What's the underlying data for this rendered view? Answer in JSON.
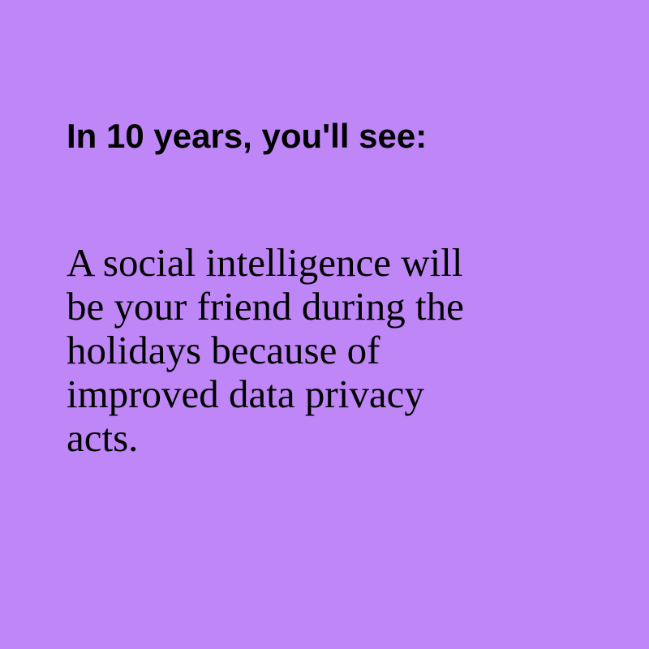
{
  "background_color": "#bf86f8",
  "text_color": "#000000",
  "heading": "In 10 years, you'll see:",
  "body": {
    "lines": [
      "A social intelligence will",
      "be your friend during the",
      "holidays because of",
      "improved data privacy",
      "acts."
    ]
  }
}
